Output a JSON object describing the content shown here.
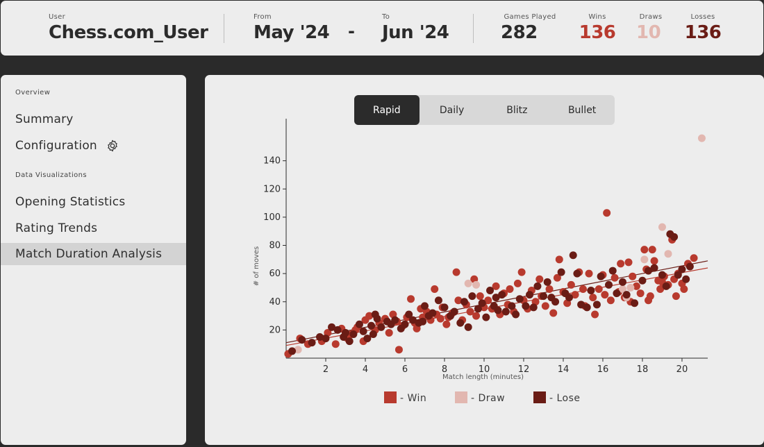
{
  "header": {
    "user_label": "User",
    "user_value": "Chess.com_User",
    "from_label": "From",
    "from_value": "May '24",
    "separator": "-",
    "to_label": "To",
    "to_value": "Jun '24",
    "games_label": "Games Played",
    "games_value": "282",
    "wins_label": "Wins",
    "wins_value": "136",
    "draws_label": "Draws",
    "draws_value": "10",
    "losses_label": "Losses",
    "losses_value": "136"
  },
  "sidebar": {
    "overview_section": "Overview",
    "summary": "Summary",
    "configuration": "Configuration",
    "dataviz_section": "Data Visualizations",
    "opening_statistics": "Opening Statistics",
    "rating_trends": "Rating Trends",
    "match_duration_analysis": "Match Duration Analysis",
    "active_item": "Match Duration Analysis"
  },
  "tabs": {
    "items": [
      "Rapid",
      "Daily",
      "Blitz",
      "Bullet"
    ],
    "active": "Rapid"
  },
  "colors": {
    "win": "#b83a2e",
    "draw": "#e2b7b0",
    "lose": "#6a1c15",
    "active_tab": "#2b2b2b"
  },
  "chart_data": {
    "type": "scatter",
    "xlabel": "Match length (minutes)",
    "ylabel": "# of moves",
    "xlim": [
      0,
      21.3
    ],
    "ylim": [
      0,
      160
    ],
    "xticks": [
      2,
      4,
      6,
      8,
      10,
      12,
      14,
      16,
      18,
      20
    ],
    "yticks": [
      20,
      40,
      60,
      80,
      100,
      120,
      140
    ],
    "legend": [
      "- Win",
      "- Draw",
      "- Lose"
    ],
    "legend_position": "bottom-center",
    "grid": false,
    "trendlines": [
      {
        "series": "Lose",
        "x": [
          0,
          21.3
        ],
        "y": [
          11,
          69
        ]
      },
      {
        "series": "Win",
        "x": [
          0,
          21.3
        ],
        "y": [
          9,
          64
        ]
      }
    ],
    "series": [
      {
        "name": "Win",
        "points": [
          [
            0.1,
            3
          ],
          [
            0.7,
            14
          ],
          [
            1.1,
            10
          ],
          [
            1.8,
            12
          ],
          [
            2.1,
            18
          ],
          [
            2.5,
            10
          ],
          [
            2.8,
            21
          ],
          [
            3.1,
            14
          ],
          [
            3.3,
            17
          ],
          [
            3.6,
            22
          ],
          [
            3.9,
            12
          ],
          [
            4.0,
            27
          ],
          [
            4.2,
            30
          ],
          [
            4.5,
            20
          ],
          [
            4.7,
            25
          ],
          [
            5.0,
            28
          ],
          [
            5.2,
            18
          ],
          [
            5.4,
            31
          ],
          [
            5.6,
            26
          ],
          [
            5.7,
            6
          ],
          [
            5.9,
            23
          ],
          [
            6.1,
            29
          ],
          [
            6.3,
            42
          ],
          [
            6.5,
            25
          ],
          [
            6.6,
            21
          ],
          [
            6.8,
            35
          ],
          [
            6.9,
            29
          ],
          [
            7.1,
            33
          ],
          [
            7.3,
            27
          ],
          [
            7.5,
            49
          ],
          [
            7.6,
            31
          ],
          [
            7.8,
            28
          ],
          [
            7.9,
            36
          ],
          [
            8.1,
            24
          ],
          [
            8.2,
            29
          ],
          [
            8.4,
            32
          ],
          [
            8.6,
            61
          ],
          [
            8.7,
            41
          ],
          [
            8.9,
            27
          ],
          [
            9.1,
            38
          ],
          [
            9.3,
            33
          ],
          [
            9.5,
            56
          ],
          [
            9.6,
            30
          ],
          [
            9.8,
            44
          ],
          [
            10.0,
            36
          ],
          [
            10.2,
            41
          ],
          [
            10.4,
            35
          ],
          [
            10.6,
            51
          ],
          [
            10.8,
            31
          ],
          [
            11.0,
            46
          ],
          [
            11.2,
            38
          ],
          [
            11.3,
            49
          ],
          [
            11.5,
            33
          ],
          [
            11.7,
            53
          ],
          [
            11.9,
            61
          ],
          [
            12.0,
            41
          ],
          [
            12.2,
            35
          ],
          [
            12.4,
            48
          ],
          [
            12.6,
            40
          ],
          [
            12.8,
            56
          ],
          [
            12.9,
            44
          ],
          [
            13.1,
            37
          ],
          [
            13.3,
            49
          ],
          [
            13.5,
            32
          ],
          [
            13.7,
            57
          ],
          [
            13.8,
            70
          ],
          [
            14.0,
            47
          ],
          [
            14.2,
            39
          ],
          [
            14.4,
            52
          ],
          [
            14.6,
            45
          ],
          [
            14.8,
            61
          ],
          [
            15.0,
            49
          ],
          [
            15.1,
            37
          ],
          [
            15.3,
            60
          ],
          [
            15.5,
            43
          ],
          [
            15.6,
            31
          ],
          [
            15.8,
            49
          ],
          [
            16.0,
            59
          ],
          [
            16.1,
            45
          ],
          [
            16.2,
            103
          ],
          [
            16.4,
            41
          ],
          [
            16.6,
            57
          ],
          [
            16.8,
            47
          ],
          [
            16.9,
            67
          ],
          [
            17.1,
            43
          ],
          [
            17.3,
            68
          ],
          [
            17.4,
            40
          ],
          [
            17.5,
            58
          ],
          [
            17.7,
            51
          ],
          [
            17.9,
            46
          ],
          [
            18.1,
            77
          ],
          [
            18.2,
            63
          ],
          [
            18.3,
            41
          ],
          [
            18.4,
            44
          ],
          [
            18.5,
            77
          ],
          [
            18.6,
            69
          ],
          [
            18.8,
            55
          ],
          [
            18.9,
            49
          ],
          [
            19.0,
            54
          ],
          [
            19.1,
            58
          ],
          [
            19.3,
            52
          ],
          [
            19.5,
            84
          ],
          [
            19.6,
            56
          ],
          [
            19.7,
            44
          ],
          [
            19.8,
            60
          ],
          [
            20.0,
            53
          ],
          [
            20.1,
            49
          ],
          [
            20.3,
            67
          ],
          [
            20.6,
            71
          ],
          [
            3.5,
            20
          ]
        ]
      },
      {
        "name": "Draw",
        "points": [
          [
            0.6,
            6
          ],
          [
            9.2,
            53
          ],
          [
            9.6,
            52
          ],
          [
            17.0,
            49
          ],
          [
            17.2,
            43
          ],
          [
            17.4,
            50
          ],
          [
            18.1,
            70
          ],
          [
            19.0,
            93
          ],
          [
            19.3,
            74
          ],
          [
            21.0,
            156
          ]
        ]
      },
      {
        "name": "Lose",
        "points": [
          [
            0.3,
            5
          ],
          [
            0.8,
            13
          ],
          [
            1.3,
            11
          ],
          [
            1.7,
            15
          ],
          [
            2.0,
            14
          ],
          [
            2.3,
            22
          ],
          [
            2.6,
            20
          ],
          [
            2.9,
            15
          ],
          [
            3.0,
            18
          ],
          [
            3.2,
            12
          ],
          [
            3.4,
            17
          ],
          [
            3.7,
            24
          ],
          [
            3.9,
            19
          ],
          [
            4.1,
            14
          ],
          [
            4.3,
            23
          ],
          [
            4.4,
            17
          ],
          [
            4.6,
            28
          ],
          [
            4.8,
            22
          ],
          [
            5.1,
            26
          ],
          [
            5.3,
            24
          ],
          [
            5.5,
            27
          ],
          [
            5.8,
            21
          ],
          [
            6.0,
            24
          ],
          [
            6.2,
            31
          ],
          [
            6.4,
            27
          ],
          [
            6.7,
            25
          ],
          [
            7.0,
            37
          ],
          [
            7.2,
            30
          ],
          [
            7.4,
            32
          ],
          [
            7.7,
            41
          ],
          [
            8.0,
            36
          ],
          [
            8.3,
            30
          ],
          [
            8.5,
            33
          ],
          [
            8.8,
            25
          ],
          [
            9.0,
            40
          ],
          [
            9.2,
            22
          ],
          [
            9.4,
            44
          ],
          [
            9.7,
            35
          ],
          [
            9.9,
            39
          ],
          [
            10.1,
            29
          ],
          [
            10.3,
            48
          ],
          [
            10.5,
            37
          ],
          [
            10.7,
            34
          ],
          [
            10.9,
            45
          ],
          [
            11.1,
            33
          ],
          [
            11.4,
            37
          ],
          [
            11.6,
            31
          ],
          [
            11.8,
            42
          ],
          [
            12.1,
            37
          ],
          [
            12.3,
            45
          ],
          [
            12.5,
            36
          ],
          [
            12.7,
            51
          ],
          [
            13.0,
            44
          ],
          [
            13.2,
            54
          ],
          [
            13.4,
            43
          ],
          [
            13.6,
            40
          ],
          [
            13.9,
            61
          ],
          [
            14.1,
            46
          ],
          [
            14.3,
            43
          ],
          [
            14.5,
            73
          ],
          [
            14.7,
            60
          ],
          [
            14.9,
            38
          ],
          [
            15.2,
            36
          ],
          [
            15.4,
            48
          ],
          [
            15.7,
            38
          ],
          [
            15.9,
            58
          ],
          [
            16.3,
            52
          ],
          [
            16.5,
            62
          ],
          [
            16.7,
            46
          ],
          [
            17.0,
            54
          ],
          [
            17.2,
            45
          ],
          [
            17.6,
            39
          ],
          [
            18.0,
            55
          ],
          [
            18.3,
            62
          ],
          [
            18.6,
            64
          ],
          [
            19.0,
            59
          ],
          [
            19.2,
            51
          ],
          [
            19.4,
            88
          ],
          [
            19.6,
            86
          ],
          [
            19.8,
            59
          ],
          [
            20.0,
            63
          ],
          [
            20.2,
            56
          ],
          [
            20.4,
            65
          ],
          [
            4.5,
            31
          ],
          [
            6.9,
            26
          ],
          [
            10.6,
            43
          ]
        ]
      }
    ]
  }
}
